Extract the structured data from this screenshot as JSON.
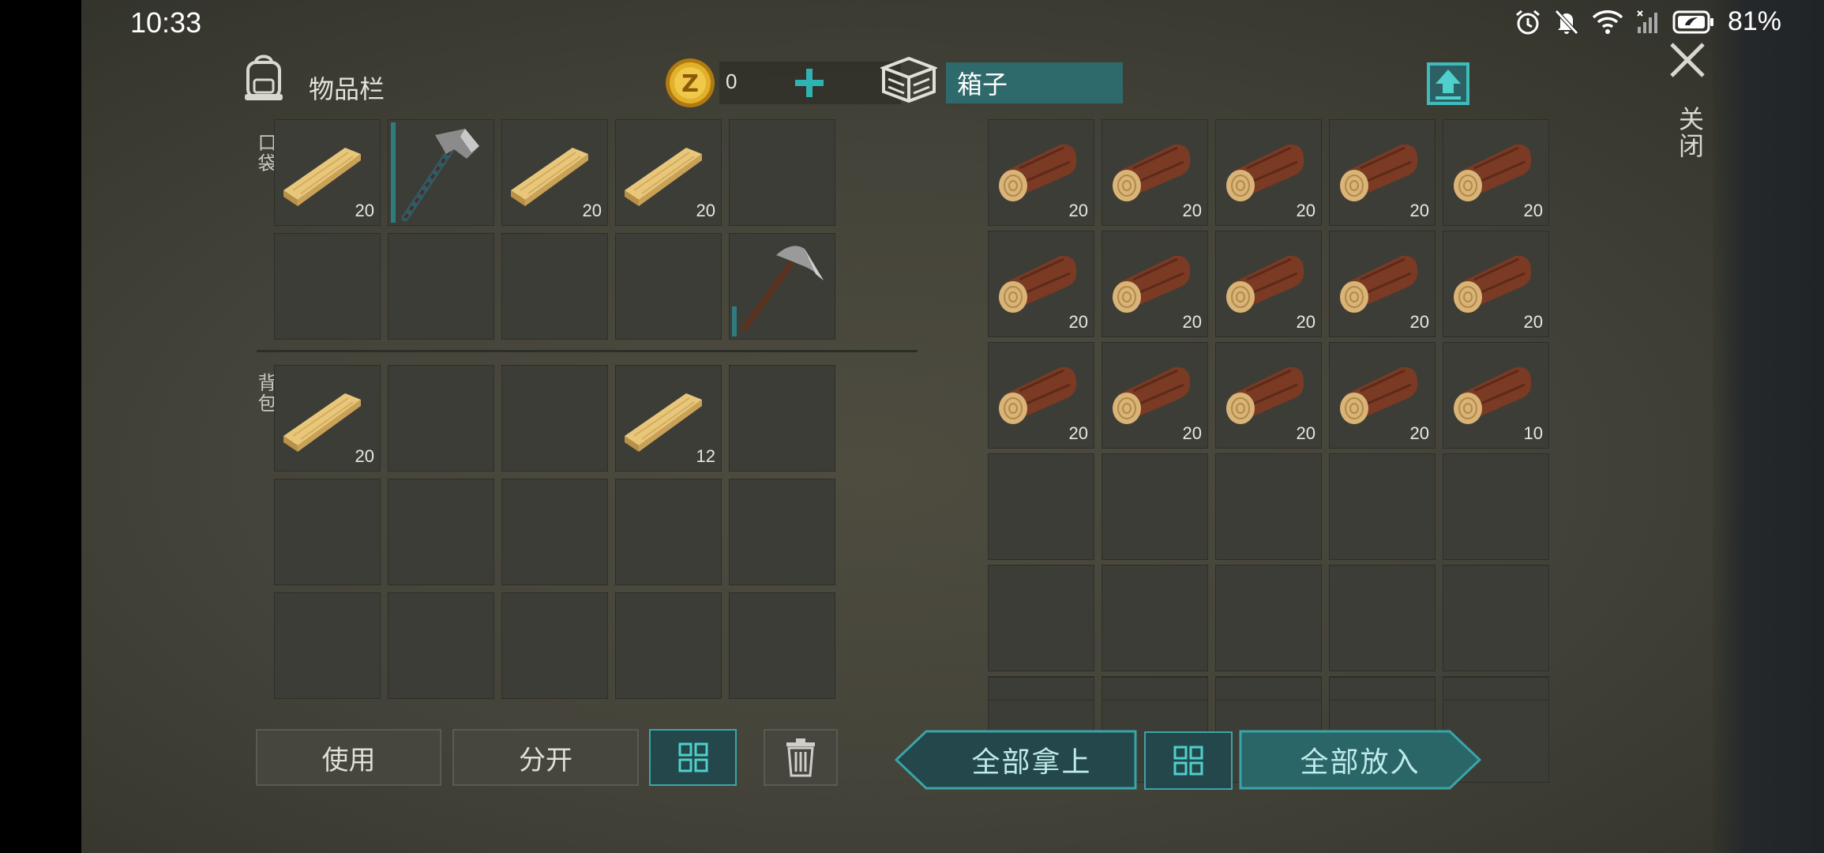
{
  "status": {
    "time": "10:33",
    "battery": "81%",
    "icons": [
      "alarm-icon",
      "mute-icon",
      "wifi-icon",
      "signal-icon",
      "battery-icon"
    ]
  },
  "inventory": {
    "title": "物品栏",
    "coins": "0",
    "pocket_label": "口袋",
    "backpack_label": "背包",
    "pocket": [
      {
        "item": "plank",
        "count": "20"
      },
      {
        "item": "hatchet",
        "count": "",
        "durability": 1.0
      },
      {
        "item": "plank",
        "count": "20"
      },
      {
        "item": "plank",
        "count": "20"
      },
      {
        "item": "",
        "count": ""
      },
      {
        "item": "",
        "count": ""
      },
      {
        "item": "",
        "count": ""
      },
      {
        "item": "",
        "count": ""
      },
      {
        "item": "",
        "count": ""
      },
      {
        "item": "pickaxe",
        "count": "",
        "durability": 0.3
      }
    ],
    "backpack": [
      {
        "item": "plank",
        "count": "20"
      },
      {
        "item": "",
        "count": ""
      },
      {
        "item": "",
        "count": ""
      },
      {
        "item": "plank",
        "count": "12"
      },
      {
        "item": "",
        "count": ""
      },
      {
        "item": "",
        "count": ""
      },
      {
        "item": "",
        "count": ""
      },
      {
        "item": "",
        "count": ""
      },
      {
        "item": "",
        "count": ""
      },
      {
        "item": "",
        "count": ""
      },
      {
        "item": "",
        "count": ""
      },
      {
        "item": "",
        "count": ""
      },
      {
        "item": "",
        "count": ""
      },
      {
        "item": "",
        "count": ""
      },
      {
        "item": "",
        "count": ""
      }
    ],
    "buttons": {
      "use": "使用",
      "split": "分开"
    }
  },
  "box": {
    "name": "箱子",
    "slots": [
      {
        "item": "log",
        "count": "20"
      },
      {
        "item": "log",
        "count": "20"
      },
      {
        "item": "log",
        "count": "20"
      },
      {
        "item": "log",
        "count": "20"
      },
      {
        "item": "log",
        "count": "20"
      },
      {
        "item": "log",
        "count": "20"
      },
      {
        "item": "log",
        "count": "20"
      },
      {
        "item": "log",
        "count": "20"
      },
      {
        "item": "log",
        "count": "20"
      },
      {
        "item": "log",
        "count": "20"
      },
      {
        "item": "log",
        "count": "20"
      },
      {
        "item": "log",
        "count": "20"
      },
      {
        "item": "log",
        "count": "20"
      },
      {
        "item": "log",
        "count": "20"
      },
      {
        "item": "log",
        "count": "10"
      },
      {
        "item": "",
        "count": ""
      },
      {
        "item": "",
        "count": ""
      },
      {
        "item": "",
        "count": ""
      },
      {
        "item": "",
        "count": ""
      },
      {
        "item": "",
        "count": ""
      },
      {
        "item": "",
        "count": ""
      },
      {
        "item": "",
        "count": ""
      },
      {
        "item": "",
        "count": ""
      },
      {
        "item": "",
        "count": ""
      },
      {
        "item": "",
        "count": ""
      },
      {
        "item": "",
        "count": ""
      },
      {
        "item": "",
        "count": ""
      },
      {
        "item": "",
        "count": ""
      },
      {
        "item": "",
        "count": ""
      },
      {
        "item": "",
        "count": ""
      }
    ],
    "buttons": {
      "take_all": "全部拿上",
      "put_all": "全部放入"
    }
  },
  "close_label": "关闭",
  "colors": {
    "accent": "#2e6a6c",
    "accent_light": "#3aa5a8",
    "slot": "#3d3d37",
    "bg": "#4a493d"
  }
}
